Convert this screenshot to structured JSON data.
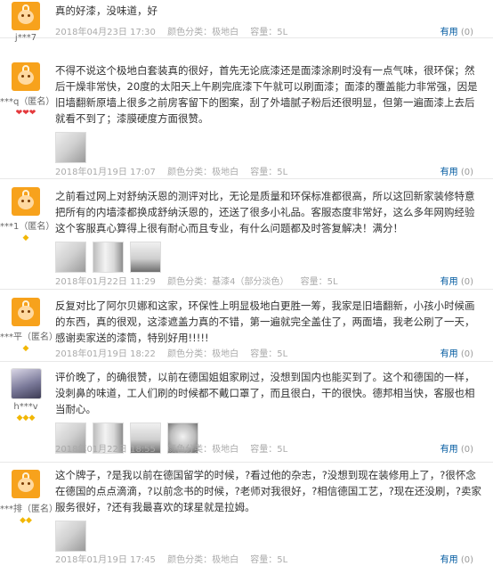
{
  "reviews": [
    {
      "username": "j***7",
      "badges": [],
      "text": "真的好漆，没味道，好",
      "photos": [],
      "date": "2018年04月23日 17:30",
      "color": "颜色分类：极地白",
      "capacity": "容量：5L",
      "useful_label": "有用",
      "useful_count": "(0)"
    },
    {
      "username": "***q（匿名）",
      "badges": [
        "red",
        "red",
        "red"
      ],
      "text": "不得不说这个极地白套装真的很好，首先无论底漆还是面漆涂刷时没有一点气味，很环保；然后干燥非常快，20度的太阳天上午刷完底漆下午就可以刷面漆；面漆的覆盖能力非常强，因是旧墙翻新原墙上很多之前房客留下的图案，刮了外墙腻子粉后还很明显，但第一遍面漆上去后就看不到了；漆膜硬度方面很赞。",
      "photos": [
        "p1"
      ],
      "date": "2018年01月19日 17:07",
      "color": "颜色分类：极地白",
      "capacity": "容量：5L",
      "useful_label": "有用",
      "useful_count": "(0)"
    },
    {
      "username": "***1（匿名）",
      "badges": [
        "yellow"
      ],
      "text": "之前看过网上对舒纳沃恩的测评对比，无论是质量和环保标准都很高，所以这回新家装修特意把所有的内墙漆都换成舒纳沃恩的，还送了很多小礼品。客服态度非常好，这么多年网购经验这个客服真心算得上很有耐心而且专业，有什么问题都及时答复解决！满分！",
      "photos": [
        "p1",
        "p2",
        "p3"
      ],
      "date": "2018年01月22日 11:29",
      "color": "颜色分类：基漆4（部分淡色）",
      "capacity": "容量：5L",
      "useful_label": "有用",
      "useful_count": "(0)"
    },
    {
      "username": "***平（匿名）",
      "badges": [
        "yellow"
      ],
      "text": "反复对比了阿尔贝娜和这家，环保性上明显极地白更胜一筹，我家是旧墙翻新，小孩小时候画的东西，真的很观，这漆遮盖力真的不错，第一遍就完全盖住了，两面墙，我老公刷了一天，感谢卖家送的漆筒，特别好用!!!!!",
      "photos": [],
      "date": "2018年01月19日 18:22",
      "color": "颜色分类：极地白",
      "capacity": "容量：5L",
      "useful_label": "有用",
      "useful_count": "(0)"
    },
    {
      "username": "h***v",
      "badges": [
        "yellow",
        "yellow",
        "yellow"
      ],
      "text": "评价晚了，的确很赞，以前在德国姐姐家刷过，没想到国内也能买到了。这个和德国的一样，没刺鼻的味道，工人们刷的时候都不戴口罩了，而且很白，干的很快。德邦相当快，客服也相当耐心。",
      "photos": [
        "p1",
        "p2",
        "p3",
        "p4"
      ],
      "date": "2018年01月22日 18:55",
      "color": "颜色分类：极地白",
      "capacity": "容量：5L",
      "useful_label": "有用",
      "useful_count": "(0)"
    },
    {
      "username": "***排（匿名）",
      "badges": [
        "yellow",
        "yellow"
      ],
      "text": "这个牌子，?是我以前在德国留学的时候，?看过他的杂志，?没想到现在装修用上了，?很怀念在德国的点点滴滴，?以前念书的时候，?老师对我很好，?相信德国工艺，?现在还没刷，?卖家服务很好，?还有我最喜欢的球星就是拉姆。",
      "photos": [
        "p1"
      ],
      "date": "2018年01月19日 17:45",
      "color": "颜色分类：极地白",
      "capacity": "容量：5L",
      "useful_label": "有用",
      "useful_count": "(0)"
    }
  ],
  "badge_glyphs": {
    "red": "❤",
    "yellow": "◆"
  },
  "colors": {
    "avatar_orange": "#f7a21c",
    "useful_link": "#005aa0",
    "meta_gray": "#aaaaaa"
  }
}
